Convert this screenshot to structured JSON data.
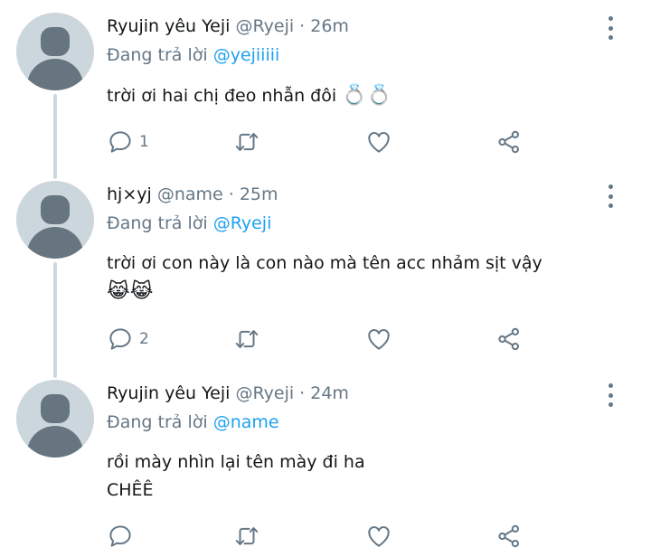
{
  "tweets": [
    {
      "display_name": "Ryujin yêu Yeji",
      "meta": "@Ryeji · 26m",
      "reply_prefix": "Đang trả lời",
      "reply_handle": "@yejiiiii",
      "text": "trời ơi hai chị đeo nhẫn đôi",
      "emoji": "💍💍",
      "reply_count": "1"
    },
    {
      "display_name": "hj×yj",
      "meta": "@name · 25m",
      "reply_prefix": "Đang trả lời",
      "reply_handle": "@Ryeji",
      "text": "trời ơi con này là con nào mà tên acc nhảm sịt vậy",
      "emoji": "😹😹",
      "reply_count": "2"
    },
    {
      "display_name": "Ryujin yêu Yeji",
      "meta": "@Ryeji · 24m",
      "reply_prefix": "Đang trả lời",
      "reply_handle": "@name",
      "text": "rồi mày nhìn lại tên mày đi ha\nCHÊÊ",
      "emoji": "",
      "reply_count": ""
    }
  ],
  "icons": {
    "reply": "reply-icon",
    "retweet": "retweet-icon",
    "like": "heart-icon",
    "share": "share-icon",
    "more": "more-vertical-icon"
  },
  "colors": {
    "link": "#1da1f2",
    "secondary_text": "#657786",
    "primary_text": "#14171a",
    "avatar_bg": "#ccd6dd",
    "avatar_fg": "#66757f"
  }
}
